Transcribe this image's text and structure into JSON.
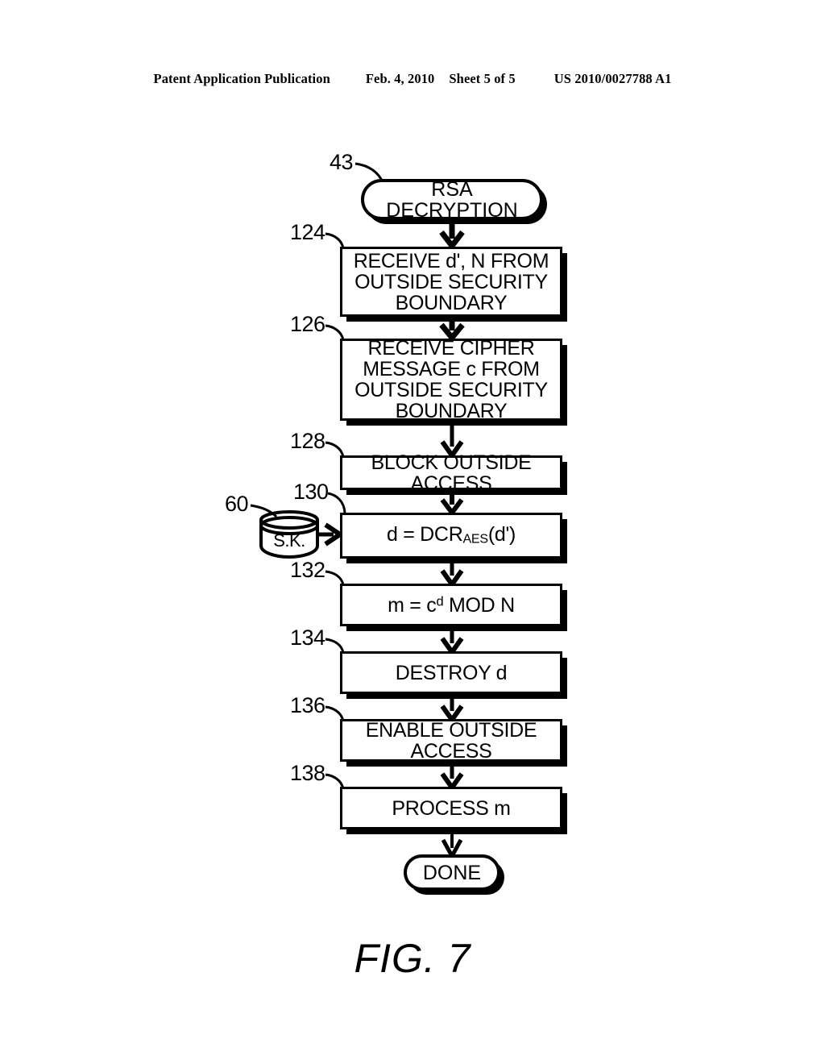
{
  "header": {
    "publication": "Patent Application Publication",
    "date": "Feb. 4, 2010",
    "sheet": "Sheet 5 of 5",
    "patent_number": "US 2010/0027788 A1"
  },
  "figure": {
    "caption": "FIG. 7",
    "title": "RSA DECRYPTION"
  },
  "refs": {
    "start": "43",
    "step_124": "124",
    "step_126": "126",
    "step_128": "128",
    "step_130": "130",
    "step_132": "132",
    "step_134": "134",
    "step_136": "136",
    "step_138": "138",
    "keystore": "60"
  },
  "nodes": {
    "start": {
      "id": "43",
      "label": "RSA DECRYPTION",
      "shape": "terminator"
    },
    "n124": {
      "id": "124",
      "label": "RECEIVE d', N FROM\nOUTSIDE SECURITY\nBOUNDARY",
      "shape": "process"
    },
    "n126": {
      "id": "126",
      "label": "RECEIVE CIPHER\nMESSAGE c FROM\nOUTSIDE SECURITY\nBOUNDARY",
      "shape": "process"
    },
    "n128": {
      "id": "128",
      "label": "BLOCK OUTSIDE ACCESS",
      "shape": "process"
    },
    "n130": {
      "id": "130",
      "label_prefix": "d = DCR",
      "label_sub": "AES",
      "label_suffix": "(d')",
      "shape": "process"
    },
    "n132": {
      "id": "132",
      "label_prefix": "m = c",
      "label_sup": "d",
      "label_suffix": " MOD N",
      "shape": "process"
    },
    "n134": {
      "id": "134",
      "label": "DESTROY d",
      "shape": "process"
    },
    "n136": {
      "id": "136",
      "label": "ENABLE OUTSIDE\nACCESS",
      "shape": "process"
    },
    "n138": {
      "id": "138",
      "label": "PROCESS m",
      "shape": "process"
    },
    "done": {
      "id": "",
      "label": "DONE",
      "shape": "terminator"
    }
  },
  "keystore": {
    "id": "60",
    "label": "S.K.",
    "shape": "cylinder"
  },
  "colors": {
    "ink": "#000000",
    "paper": "#ffffff"
  }
}
